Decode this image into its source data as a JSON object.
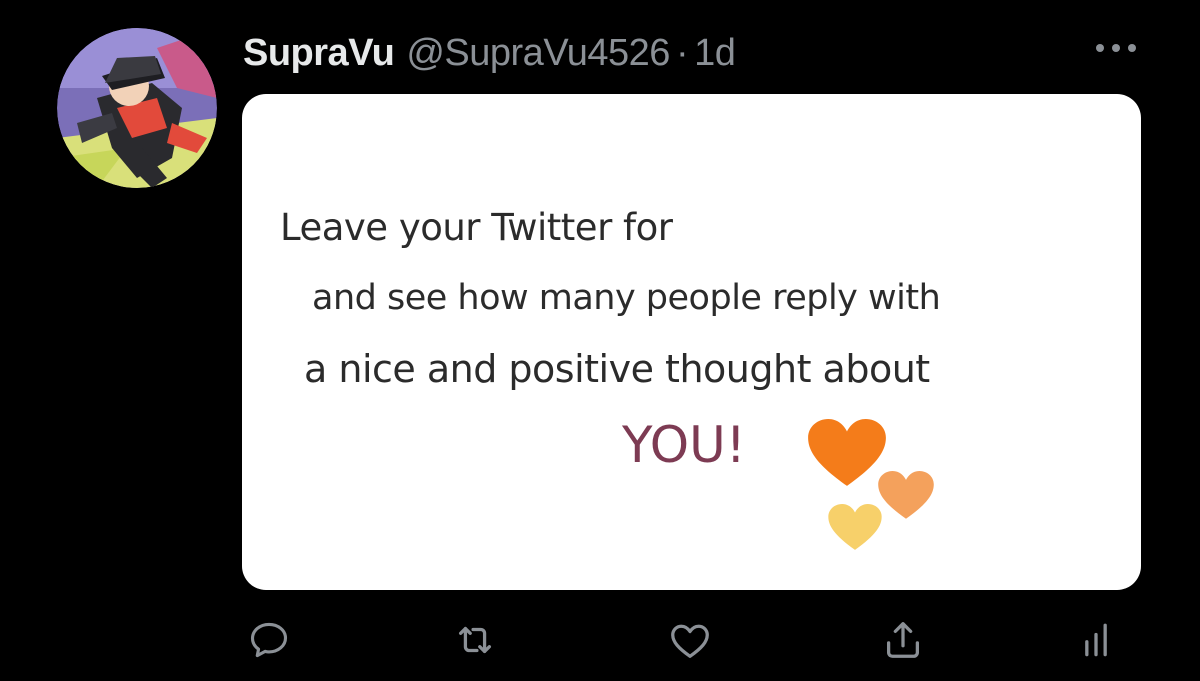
{
  "tweet": {
    "display_name": "SupraVu",
    "handle": "@SupraVu4526",
    "separator": "·",
    "time": "1d"
  },
  "media": {
    "lines": [
      "Leave your Twitter for",
      "and see how many people reply with",
      "a nice and positive thought about",
      "YOU!"
    ]
  },
  "colors": {
    "background": "#000000",
    "name": "#e7e9ea",
    "secondary": "#8b9096",
    "icon": "#8b9096",
    "heart_orange": "#f47c1a",
    "heart_peach": "#f4a15c",
    "heart_yellow": "#f7d06a",
    "you_text": "#7d3b53"
  },
  "icons": {
    "more": "more-horizontal-icon",
    "reply": "reply-icon",
    "retweet": "retweet-icon",
    "like": "heart-icon",
    "share": "share-icon",
    "analytics": "analytics-icon"
  }
}
